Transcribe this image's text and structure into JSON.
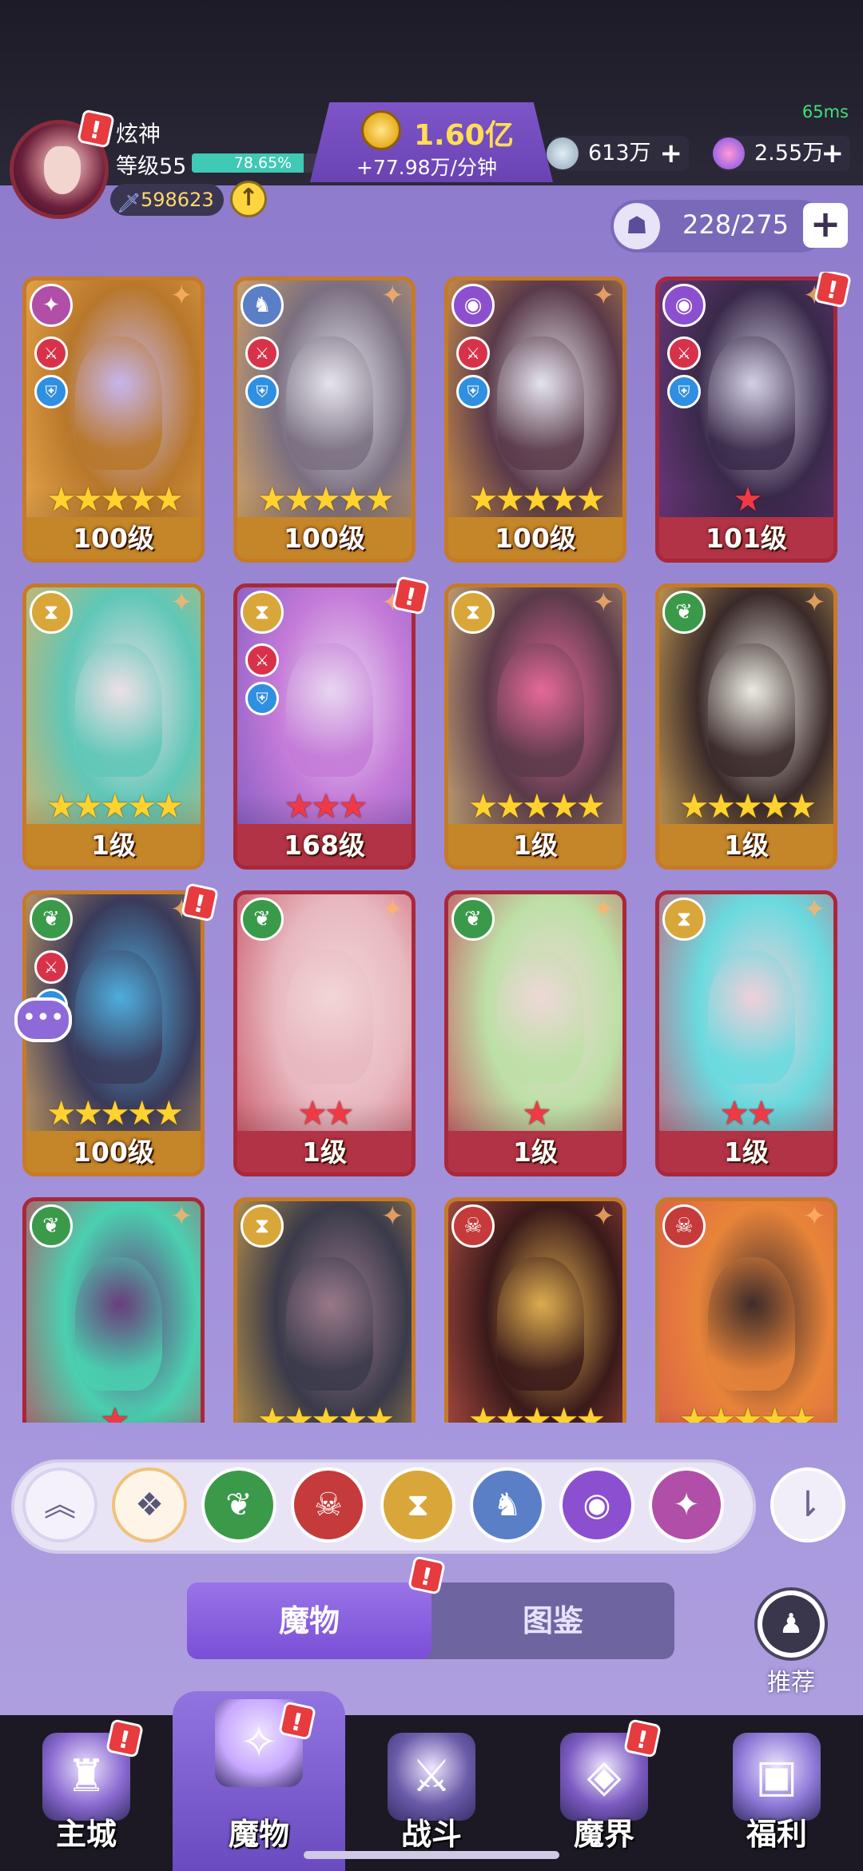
{
  "header": {
    "player_name": "炫神",
    "level": "等级55",
    "exp_percent": "78.65%",
    "exp_fraction": 0.7865,
    "power": "598623",
    "ping": "65ms",
    "gold": "1.60亿",
    "gold_rate": "+77.98万/分钟",
    "resource1": "613万",
    "resource2": "2.55万",
    "plus": "+",
    "badge": "!"
  },
  "roster": {
    "capacity": "228/275",
    "add": "+"
  },
  "monsters": [
    {
      "level": "100级",
      "stars": 5,
      "star_color": "yellow",
      "frame": "gold",
      "element": "wind",
      "element_icon": "swirl-icon",
      "has_skills": true,
      "badge": false
    },
    {
      "level": "100级",
      "stars": 5,
      "star_color": "yellow",
      "frame": "gold",
      "element": "dragon",
      "element_icon": "wolf-icon",
      "has_skills": true,
      "badge": false
    },
    {
      "level": "100级",
      "stars": 5,
      "star_color": "yellow",
      "frame": "gold",
      "element": "eye",
      "element_icon": "eye-icon",
      "has_skills": true,
      "badge": false
    },
    {
      "level": "101级",
      "stars": 1,
      "star_color": "red",
      "frame": "red",
      "element": "eye",
      "element_icon": "eye-icon",
      "has_skills": true,
      "badge": true
    },
    {
      "level": "1级",
      "stars": 5,
      "star_color": "yellow",
      "frame": "gold",
      "element": "sand",
      "element_icon": "hourglass-icon",
      "has_skills": false,
      "badge": false
    },
    {
      "level": "168级",
      "stars": 3,
      "star_color": "red",
      "frame": "red",
      "element": "sand",
      "element_icon": "hourglass-icon",
      "has_skills": true,
      "badge": true
    },
    {
      "level": "1级",
      "stars": 5,
      "star_color": "yellow",
      "frame": "gold",
      "element": "sand",
      "element_icon": "hourglass-icon",
      "has_skills": false,
      "badge": false
    },
    {
      "level": "1级",
      "stars": 5,
      "star_color": "yellow",
      "frame": "gold",
      "element": "leaf",
      "element_icon": "leaf-icon",
      "has_skills": false,
      "badge": false
    },
    {
      "level": "100级",
      "stars": 5,
      "star_color": "yellow",
      "frame": "gold",
      "element": "leaf",
      "element_icon": "leaf-icon",
      "has_skills": true,
      "badge": true
    },
    {
      "level": "1级",
      "stars": 2,
      "star_color": "red",
      "frame": "red",
      "element": "leaf",
      "element_icon": "leaf-icon",
      "has_skills": false,
      "badge": false
    },
    {
      "level": "1级",
      "stars": 1,
      "star_color": "red",
      "frame": "red",
      "element": "leaf",
      "element_icon": "leaf-icon",
      "has_skills": false,
      "badge": false
    },
    {
      "level": "1级",
      "stars": 2,
      "star_color": "red",
      "frame": "red",
      "element": "sand",
      "element_icon": "hourglass-icon",
      "has_skills": false,
      "badge": false
    },
    {
      "level": "",
      "stars": 1,
      "star_color": "red",
      "frame": "red",
      "element": "leaf",
      "element_icon": "leaf-icon",
      "has_skills": false,
      "badge": false
    },
    {
      "level": "",
      "stars": 5,
      "star_color": "yellow",
      "frame": "gold",
      "element": "sand",
      "element_icon": "hourglass-icon",
      "has_skills": false,
      "badge": false
    },
    {
      "level": "",
      "stars": 5,
      "star_color": "yellow",
      "frame": "gold",
      "element": "demon",
      "element_icon": "demon-icon",
      "has_skills": false,
      "badge": false
    },
    {
      "level": "",
      "stars": 5,
      "star_color": "yellow",
      "frame": "gold",
      "element": "demon",
      "element_icon": "demon-icon",
      "has_skills": false,
      "badge": false
    }
  ],
  "filters": [
    {
      "name": "collapse",
      "icon": "chevron-up-icon",
      "color": "#f4f1fb"
    },
    {
      "name": "all",
      "icon": "grid-diamond-icon",
      "color": "#fff4e8"
    },
    {
      "name": "leaf",
      "icon": "leaf-icon",
      "color": "#3a9a4a"
    },
    {
      "name": "demon",
      "icon": "demon-icon",
      "color": "#c53a3a"
    },
    {
      "name": "sand",
      "icon": "hourglass-icon",
      "color": "#d9a63a"
    },
    {
      "name": "dragon",
      "icon": "wolf-icon",
      "color": "#5a7fc6"
    },
    {
      "name": "eye",
      "icon": "eye-icon",
      "color": "#8b4fcf"
    },
    {
      "name": "wind",
      "icon": "swirl-icon",
      "color": "#b04ea8"
    }
  ],
  "tabs": {
    "monsters": "魔物",
    "codex": "图鉴"
  },
  "recommend": "推荐",
  "nav": [
    {
      "label": "主城",
      "icon": "castle-icon",
      "badge": true,
      "active": false
    },
    {
      "label": "魔物",
      "icon": "flame-star-icon",
      "badge": true,
      "active": true
    },
    {
      "label": "战斗",
      "icon": "sword-shield-icon",
      "badge": false,
      "active": false
    },
    {
      "label": "魔界",
      "icon": "portal-icon",
      "badge": true,
      "active": false
    },
    {
      "label": "福利",
      "icon": "chest-icon",
      "badge": false,
      "active": false
    }
  ],
  "colors": {
    "accent": "#7a4fd6",
    "gold_frame": "#c77a26",
    "red_frame": "#a8283a",
    "exp_bar": "#40c9b5"
  }
}
